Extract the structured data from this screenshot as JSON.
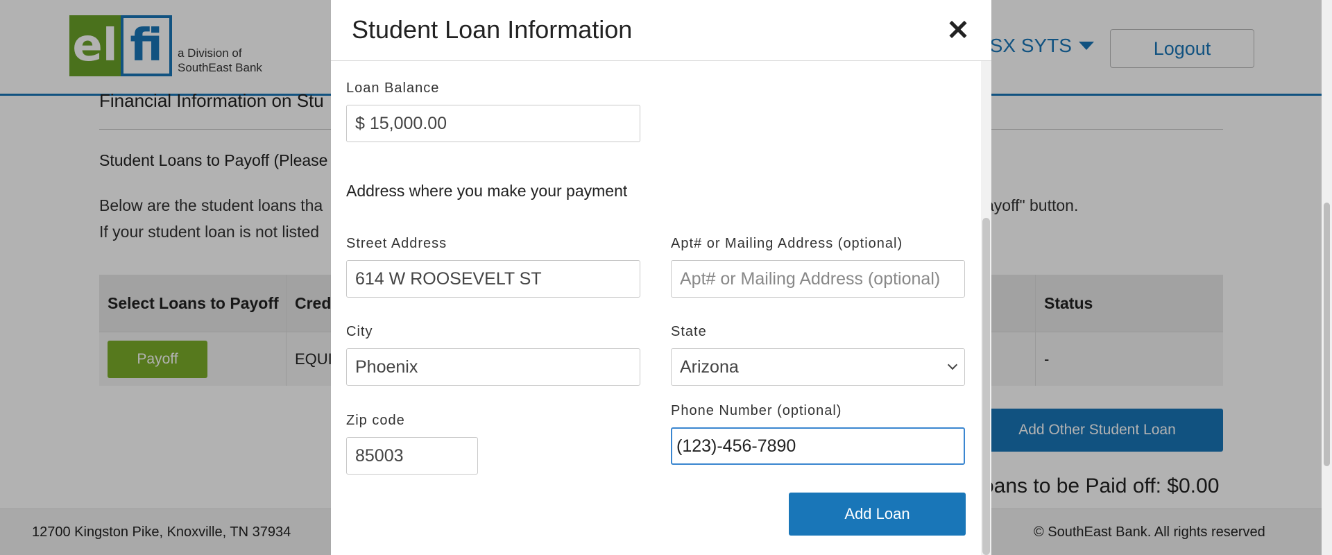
{
  "header": {
    "logo_el": "el",
    "logo_fi": "fi",
    "logo_tagline_1": "a Division of",
    "logo_tagline_2": "SouthEast Bank",
    "user_name": "SSX SYTS",
    "logout_label": "Logout"
  },
  "main": {
    "section_title": "Financial Information on Stu",
    "loans_heading": "Student Loans to Payoff (Please",
    "description_line1": "Below are the student loans tha",
    "description_line1_right": "ayoff\" button.",
    "description_line2": "If your student loan is not listed",
    "table": {
      "headers": [
        "Select Loans to Payoff",
        "Cred",
        "Status"
      ],
      "rows": [
        {
          "action": "Payoff",
          "creditor": "EQUI",
          "status": "-"
        }
      ]
    },
    "add_other_label": "Add Other Student Loan",
    "total_text": "oans to be Paid off: $0.00"
  },
  "footer": {
    "address": "12700 Kingston Pike, Knoxville, TN 37934",
    "copyright": "© SouthEast Bank. All rights reserved"
  },
  "modal": {
    "title": "Student Loan Information",
    "close_icon": "close-icon",
    "loan_balance_label": "Loan Balance",
    "loan_balance_value": "$ 15,000.00",
    "address_heading": "Address where you make your payment",
    "street_label": "Street Address",
    "street_value": "614 W ROOSEVELT ST",
    "apt_label": "Apt# or Mailing Address (optional)",
    "apt_placeholder": "Apt# or Mailing Address (optional)",
    "city_label": "City",
    "city_value": "Phoenix",
    "state_label": "State",
    "state_value": "Arizona",
    "zip_label": "Zip code",
    "zip_value": "85003",
    "phone_label": "Phone Number (optional)",
    "phone_value": "(123)-456-7890",
    "add_loan_label": "Add Loan"
  },
  "colors": {
    "brand_blue": "#1976b8",
    "brand_green": "#6aa329",
    "payoff_green": "#7cae2a"
  }
}
